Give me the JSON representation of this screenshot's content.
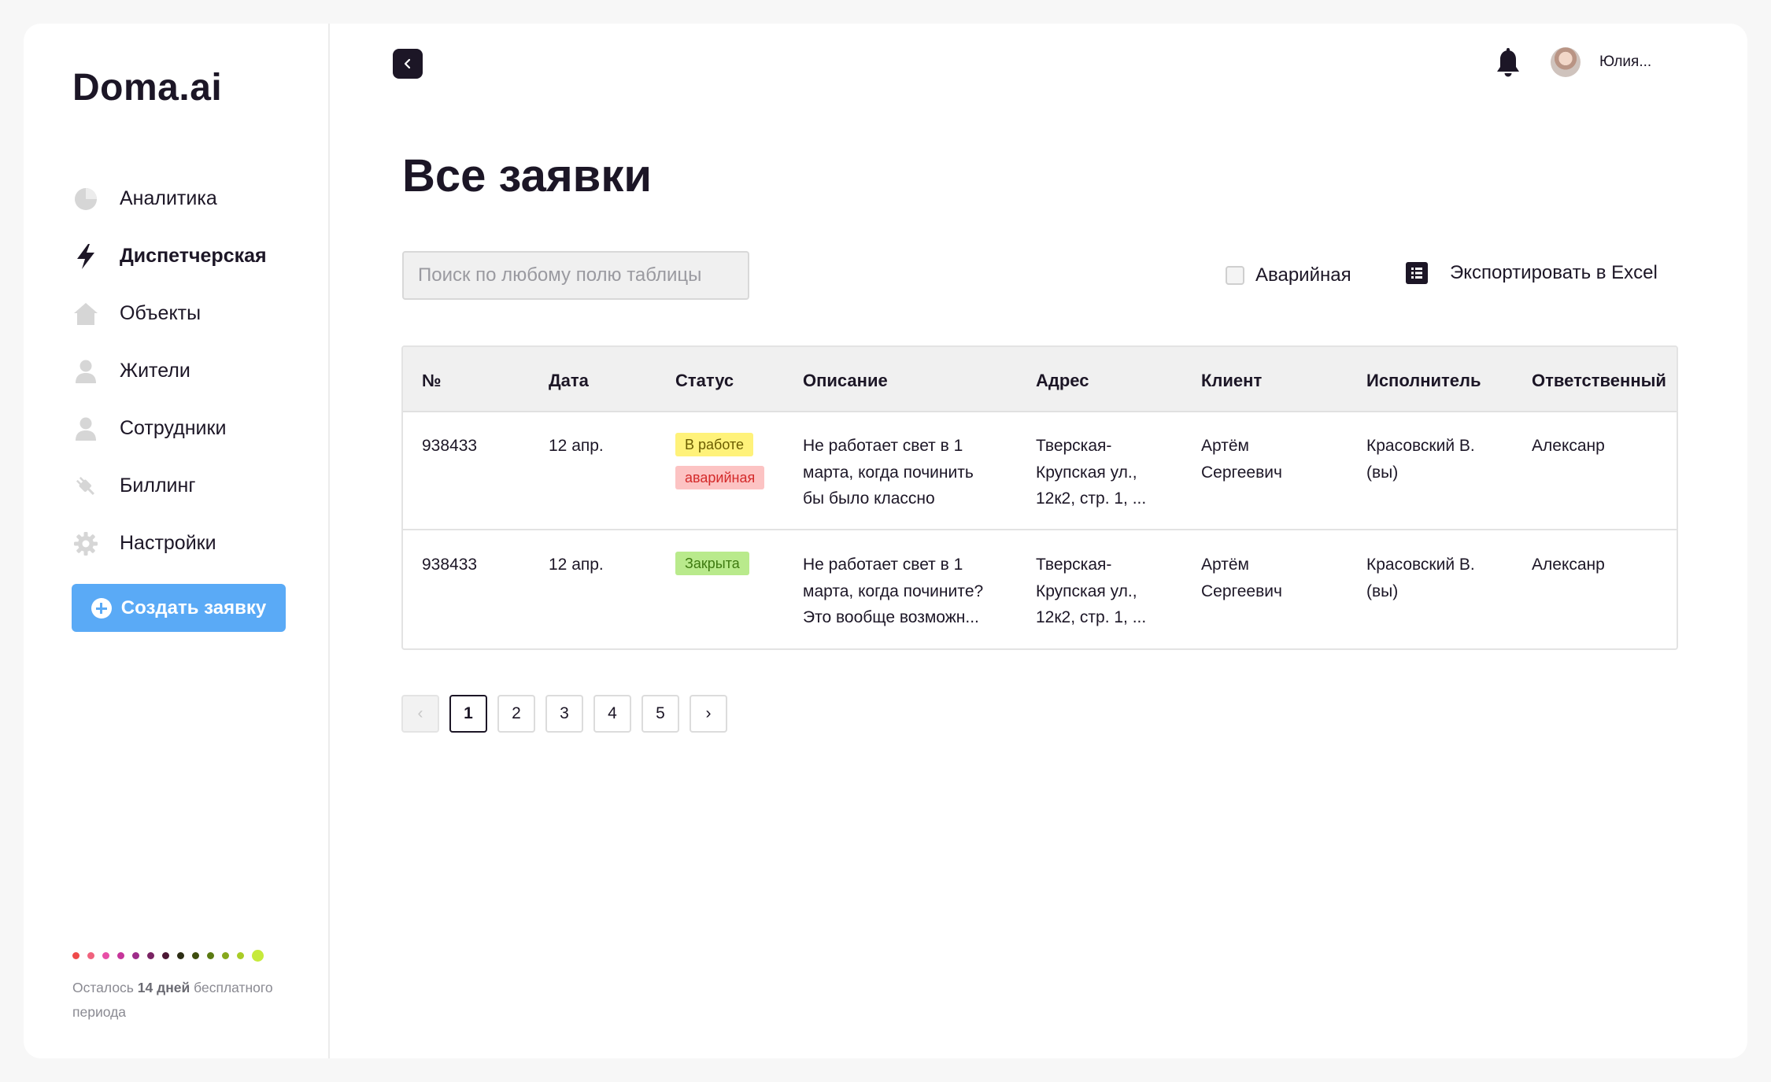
{
  "sidebar": {
    "logo": "Doma.ai",
    "items": [
      {
        "label": "Аналитика",
        "icon": "pie-chart-icon"
      },
      {
        "label": "Диспетчерская",
        "icon": "lightning-icon",
        "active": true
      },
      {
        "label": "Объекты",
        "icon": "home-icon"
      },
      {
        "label": "Жители",
        "icon": "user-icon"
      },
      {
        "label": "Сотрудники",
        "icon": "user-icon"
      },
      {
        "label": "Биллинг",
        "icon": "plug-icon"
      },
      {
        "label": "Настройки",
        "icon": "gear-icon"
      }
    ],
    "create_button": "Создать заявку",
    "trial": {
      "prefix": "Осталось ",
      "days": "14 дней",
      "suffix": " бесплатного периода"
    },
    "dot_colors": [
      "#ef4a4a",
      "#f0627d",
      "#e84fa7",
      "#c6359a",
      "#9e2c8a",
      "#7a2363",
      "#4b1734",
      "#2c2d14",
      "#3e4d0e",
      "#5a7a12",
      "#86a81c",
      "#a9cc26",
      "#c6ea3b"
    ]
  },
  "header": {
    "user_name": "Юлия..."
  },
  "main": {
    "title": "Все заявки",
    "search_placeholder": "Поиск по любому полю таблицы",
    "emergency_label": "Аварийная",
    "export_label": "Экспортировать в Excel"
  },
  "table": {
    "columns": [
      "№",
      "Дата",
      "Статус",
      "Описание",
      "Адрес",
      "Клиент",
      "Исполнитель",
      "Ответственный"
    ],
    "rows": [
      {
        "num": "938433",
        "date": "12 апр.",
        "badges": [
          {
            "text": "В работе",
            "kind": "work"
          },
          {
            "text": "аварийная",
            "kind": "alarm"
          }
        ],
        "description": [
          "Не работает свет в 1",
          "марта, когда починить",
          "бы было классно"
        ],
        "address": [
          "Тверская-",
          "Крупская ул.,",
          "12к2, стр. 1, ..."
        ],
        "client": [
          "Артём",
          "Сергеевич"
        ],
        "executor": [
          "Красовский В.",
          "(вы)"
        ],
        "responsible": "Алексанр"
      },
      {
        "num": "938433",
        "date": "12 апр.",
        "badges": [
          {
            "text": "Закрыта",
            "kind": "closed"
          }
        ],
        "description": [
          "Не работает свет в 1",
          "марта, когда починитe?",
          "Это вообще возможн..."
        ],
        "address": [
          "Тверская-",
          "Крупская ул.,",
          "12к2, стр. 1, ..."
        ],
        "client": [
          "Артём",
          "Сергеевич"
        ],
        "executor": [
          "Красовский В.",
          "(вы)"
        ],
        "responsible": "Алексанр"
      }
    ]
  },
  "pagination": {
    "pages": [
      "1",
      "2",
      "3",
      "4",
      "5"
    ],
    "current": "1",
    "prev": "‹",
    "next": "›"
  }
}
